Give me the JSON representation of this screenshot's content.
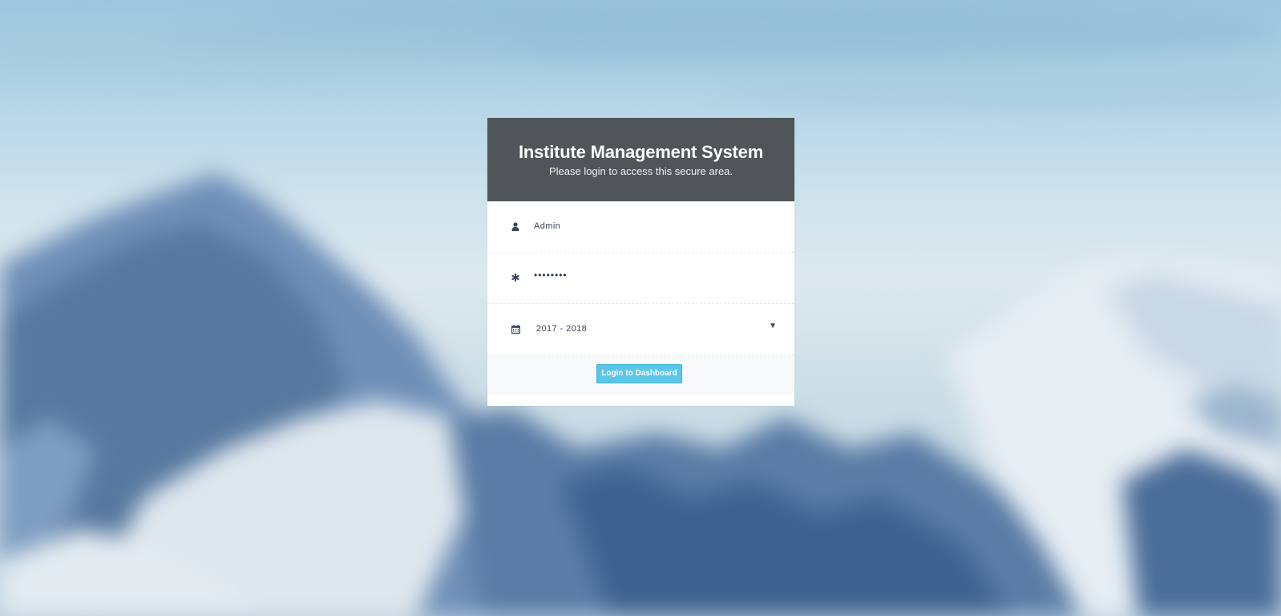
{
  "header": {
    "title": "Institute Management System",
    "subtitle": "Please login to access this secure area."
  },
  "form": {
    "username": {
      "value": "Admin",
      "icon": "user-icon"
    },
    "password": {
      "value": "••••••••",
      "icon": "asterisk-icon"
    },
    "session": {
      "value": "2017 - 2018",
      "icon": "calendar-icon",
      "dropdown_icon": "caret-down-icon"
    }
  },
  "actions": {
    "login_label": "Login to Dashboard"
  },
  "colors": {
    "header_bg": "#4f5558",
    "button_bg": "#5bc6e8",
    "text": "#3a4656"
  }
}
